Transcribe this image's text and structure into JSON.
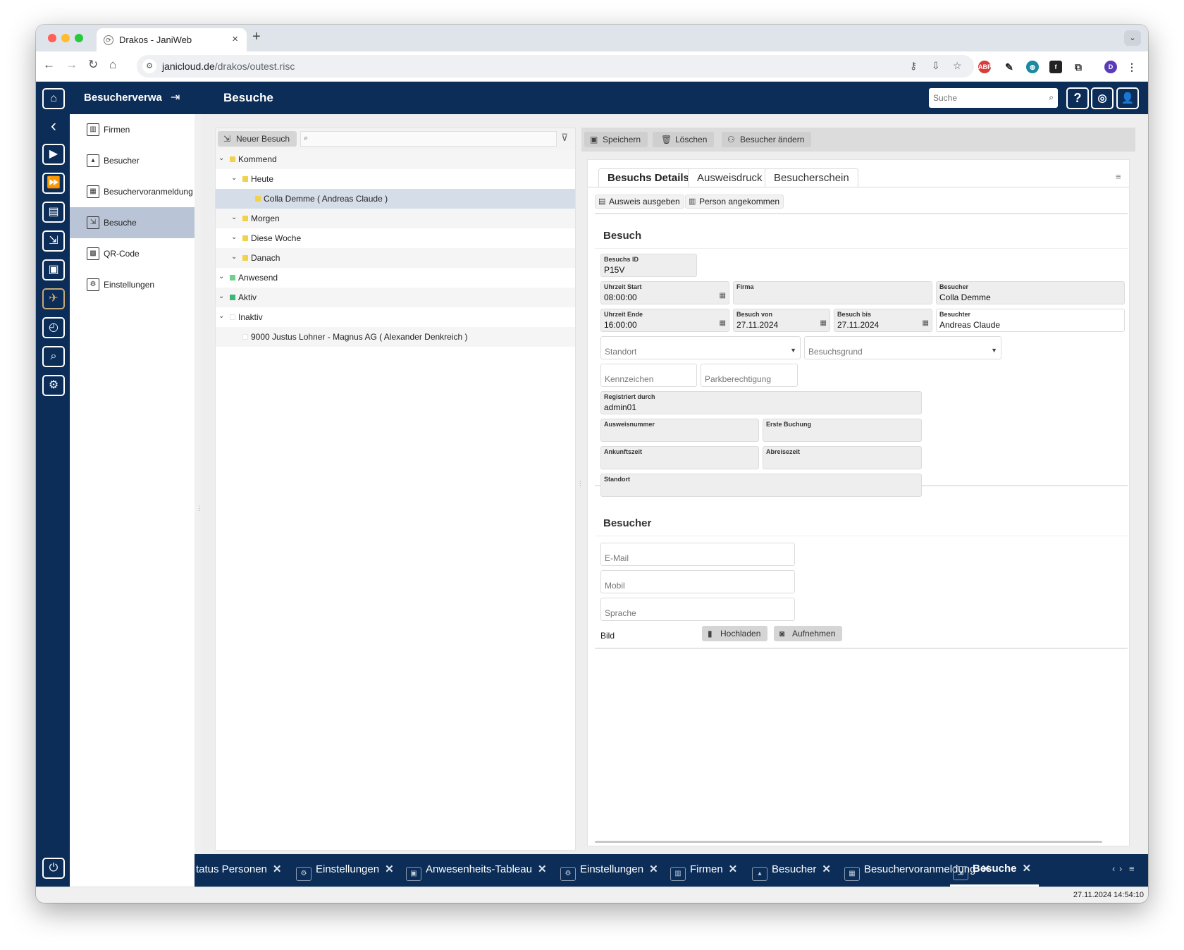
{
  "browser": {
    "tab_title": "Drakos - JaniWeb",
    "url_domain": "janicloud.de",
    "url_path": "/drakos/outest.risc"
  },
  "app": {
    "module_title": "Besucherverwa",
    "page_title": "Besuche",
    "search_placeholder": "Suche"
  },
  "sidebar": {
    "items": [
      {
        "label": "Firmen",
        "icon": "firmen-icon"
      },
      {
        "label": "Besucher",
        "icon": "besucher-icon"
      },
      {
        "label": "Besuchervoranmeldung",
        "icon": "voranmeldung-icon"
      },
      {
        "label": "Besuche",
        "icon": "besuche-icon",
        "active": true
      },
      {
        "label": "QR-Code",
        "icon": "qr-code-icon"
      },
      {
        "label": "Einstellungen",
        "icon": "settings-icon"
      }
    ]
  },
  "tree": {
    "new_button": "Neuer Besuch",
    "rows": [
      {
        "label": "Kommend",
        "level": 0,
        "color": "#f2d24b",
        "expanded": true
      },
      {
        "label": "Heute",
        "level": 1,
        "color": "#f2d24b",
        "expanded": true
      },
      {
        "label": "Colla Demme ( Andreas Claude )",
        "level": 2,
        "color": "#f2d24b",
        "selected": true
      },
      {
        "label": "Morgen",
        "level": 1,
        "color": "#f2d24b",
        "expanded": true
      },
      {
        "label": "Diese Woche",
        "level": 1,
        "color": "#f2d24b",
        "expanded": true
      },
      {
        "label": "Danach",
        "level": 1,
        "color": "#f2d24b",
        "expanded": true
      },
      {
        "label": "Anwesend",
        "level": 0,
        "color": "#6fd08c",
        "expanded": true
      },
      {
        "label": "Aktiv",
        "level": 0,
        "color": "#3fb57a",
        "expanded": true
      },
      {
        "label": "Inaktiv",
        "level": 0,
        "color": "#ffffff",
        "expanded": true
      },
      {
        "label": "9000 Justus Lohner - Magnus AG ( Alexander Denkreich )",
        "level": 1,
        "color": "#ffffff"
      }
    ]
  },
  "detail": {
    "toolbar": {
      "save": "Speichern",
      "delete": "Löschen",
      "change_visitor": "Besucher ändern"
    },
    "tabs": [
      "Besuchs Details",
      "Ausweisdruck",
      "Besucherschein"
    ],
    "actions": {
      "issue_badge": "Ausweis ausgeben",
      "person_arrived": "Person angekommen"
    },
    "besuch": {
      "title": "Besuch",
      "besuchs_id": {
        "label": "Besuchs ID",
        "value": "P15V"
      },
      "uhrzeit_start": {
        "label": "Uhrzeit Start",
        "value": "08:00:00"
      },
      "firma": {
        "label": "Firma",
        "value": ""
      },
      "besucher": {
        "label": "Besucher",
        "value": "Colla Demme"
      },
      "uhrzeit_ende": {
        "label": "Uhrzeit Ende",
        "value": "16:00:00"
      },
      "besuch_von": {
        "label": "Besuch von",
        "value": "27.11.2024"
      },
      "besuch_bis": {
        "label": "Besuch bis",
        "value": "27.11.2024"
      },
      "besuchter": {
        "label": "Besuchter",
        "value": "Andreas Claude"
      },
      "standort_placeholder": "Standort",
      "besuchsgrund_placeholder": "Besuchsgrund",
      "kennzeichen_placeholder": "Kennzeichen",
      "parkberechtigung_placeholder": "Parkberechtigung",
      "registriert_durch": {
        "label": "Registriert durch",
        "value": "admin01"
      },
      "ausweisnummer": {
        "label": "Ausweisnummer",
        "value": ""
      },
      "erste_buchung": {
        "label": "Erste Buchung",
        "value": ""
      },
      "ankunftszeit": {
        "label": "Ankunftszeit",
        "value": ""
      },
      "abreisezeit": {
        "label": "Abreisezeit",
        "value": ""
      },
      "standort": {
        "label": "Standort",
        "value": ""
      }
    },
    "besucher_section": {
      "title": "Besucher",
      "email_placeholder": "E-Mail",
      "mobil_placeholder": "Mobil",
      "sprache_placeholder": "Sprache",
      "bild_label": "Bild",
      "upload": "Hochladen",
      "capture": "Aufnehmen"
    }
  },
  "bottom_tabs": [
    {
      "label": "tatus Personen"
    },
    {
      "label": "Einstellungen"
    },
    {
      "label": "Anwesenheits-Tableau"
    },
    {
      "label": "Einstellungen"
    },
    {
      "label": "Firmen"
    },
    {
      "label": "Besucher"
    },
    {
      "label": "Besuchervoranmeldung"
    },
    {
      "label": "Besuche",
      "active": true
    }
  ],
  "status_timestamp": "27.11.2024 14:54:10",
  "colors": {
    "header": "#0b2d57",
    "active_nav": "#b9c5d6",
    "selected_row": "#d5dde8"
  }
}
